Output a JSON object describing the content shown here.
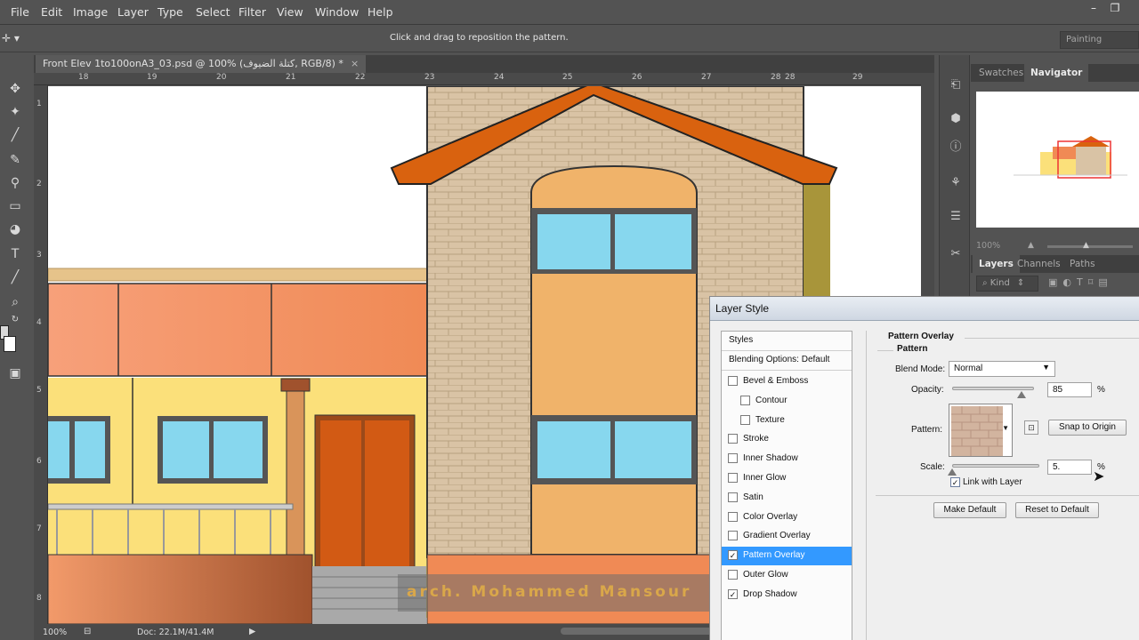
{
  "menubar": {
    "items": [
      "File",
      "Edit",
      "Image",
      "Layer",
      "Type",
      "Select",
      "Filter",
      "View",
      "Window",
      "Help"
    ],
    "minimize_icon": "minimize-icon",
    "restore_icon": "restore-icon"
  },
  "options": {
    "hint": "Click and drag to reposition the pattern.",
    "workspace": "Painting"
  },
  "document": {
    "tab_title": "Front Elev 1to100onA3_03.psd @ 100% (كتلة الضيوف, RGB/8) *",
    "close": "×",
    "ruler_top": [
      "18",
      "19",
      "20",
      "21",
      "22",
      "23",
      "24",
      "25",
      "26",
      "27",
      "28",
      "28",
      "29"
    ],
    "ruler_left": [
      "1",
      "2",
      "3",
      "4",
      "5",
      "6",
      "7",
      "8"
    ],
    "zoom": "100%",
    "doc_size": "Doc: 22.1M/41.4M"
  },
  "panels": {
    "swatches": "Swatches",
    "navigator": "Navigator",
    "nav_zoom": "100%",
    "layers": "Layers",
    "channels": "Channels",
    "paths": "Paths",
    "kind": "Kind"
  },
  "dialog": {
    "title": "Layer Style",
    "styles_header": "Styles",
    "blending": "Blending Options: Default",
    "items": [
      {
        "label": "Bevel & Emboss",
        "checked": false,
        "sub": false
      },
      {
        "label": "Contour",
        "checked": false,
        "sub": true
      },
      {
        "label": "Texture",
        "checked": false,
        "sub": true
      },
      {
        "label": "Stroke",
        "checked": false,
        "sub": false
      },
      {
        "label": "Inner Shadow",
        "checked": false,
        "sub": false
      },
      {
        "label": "Inner Glow",
        "checked": false,
        "sub": false
      },
      {
        "label": "Satin",
        "checked": false,
        "sub": false
      },
      {
        "label": "Color Overlay",
        "checked": false,
        "sub": false
      },
      {
        "label": "Gradient Overlay",
        "checked": false,
        "sub": false
      },
      {
        "label": "Pattern Overlay",
        "checked": true,
        "sub": false,
        "active": true
      },
      {
        "label": "Outer Glow",
        "checked": false,
        "sub": false
      },
      {
        "label": "Drop Shadow",
        "checked": true,
        "sub": false
      }
    ],
    "section_title": "Pattern Overlay",
    "group_title": "Pattern",
    "blend_mode_label": "Blend Mode:",
    "blend_mode_value": "Normal",
    "opacity_label": "Opacity:",
    "opacity_value": "85",
    "opacity_fraction": 0.85,
    "percent": "%",
    "pattern_label": "Pattern:",
    "snap_button": "Snap to Origin",
    "scale_label": "Scale:",
    "scale_value": "5.",
    "scale_fraction": 0.0,
    "link_label": "Link with Layer",
    "link_checked": true,
    "make_default": "Make Default",
    "reset_default": "Reset to Default"
  },
  "watermark": "arch. Mohammed Mansour"
}
